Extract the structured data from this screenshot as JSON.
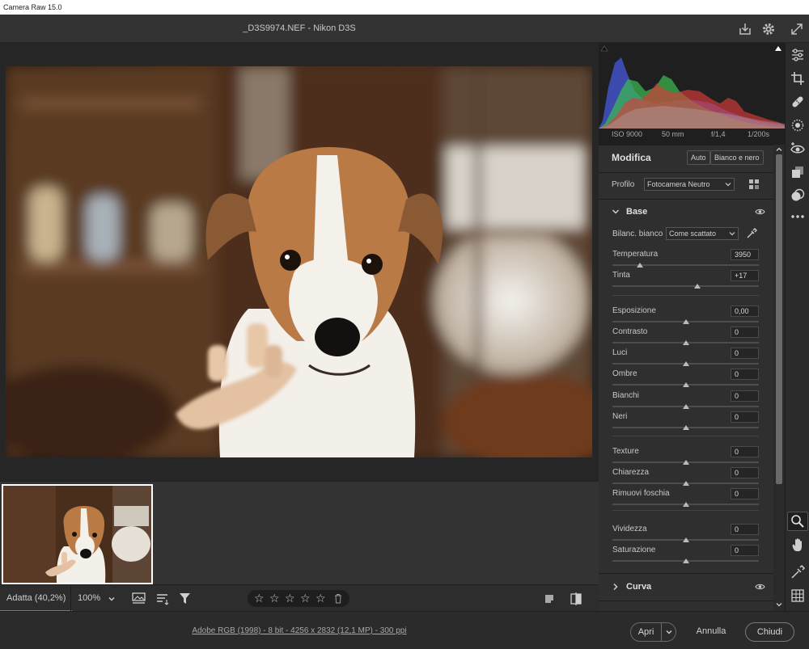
{
  "window": {
    "title": "Camera Raw 15.0"
  },
  "header": {
    "file_title": "_D3S9974.NEF  -  Nikon D3S"
  },
  "histogram": {
    "iso": "ISO 9000",
    "focal": "50 mm",
    "aperture": "f/1,4",
    "shutter": "1/200s"
  },
  "edit": {
    "title": "Modifica",
    "auto_label": "Auto",
    "bw_label": "Bianco e nero",
    "profile_label": "Profilo",
    "profile_value": "Fotocamera Neutro"
  },
  "basic": {
    "title": "Base",
    "wb_label": "Bilanc. bianco",
    "wb_value": "Come scattato",
    "sliders": [
      {
        "label": "Temperatura",
        "value": "3950",
        "pos": 0.19
      },
      {
        "label": "Tinta",
        "value": "+17",
        "pos": 0.58
      },
      {
        "label": "Esposizione",
        "value": "0,00",
        "pos": 0.5
      },
      {
        "label": "Contrasto",
        "value": "0",
        "pos": 0.5
      },
      {
        "label": "Luci",
        "value": "0",
        "pos": 0.5
      },
      {
        "label": "Ombre",
        "value": "0",
        "pos": 0.5
      },
      {
        "label": "Bianchi",
        "value": "0",
        "pos": 0.5
      },
      {
        "label": "Neri",
        "value": "0",
        "pos": 0.5
      },
      {
        "label": "Texture",
        "value": "0",
        "pos": 0.5
      },
      {
        "label": "Chiarezza",
        "value": "0",
        "pos": 0.5
      },
      {
        "label": "Rimuovi foschia",
        "value": "0",
        "pos": 0.5
      },
      {
        "label": "Vividezza",
        "value": "0",
        "pos": 0.5
      },
      {
        "label": "Saturazione",
        "value": "0",
        "pos": 0.5
      }
    ]
  },
  "curve": {
    "title": "Curva"
  },
  "toolbar": {
    "zoom_fit": "Adatta (40,2%)",
    "zoom_100": "100%"
  },
  "status": {
    "info": "Adobe RGB (1998) - 8 bit - 4256 x 2832 (12,1 MP) - 300 ppi"
  },
  "buttons": {
    "open": "Apri",
    "cancel": "Annulla",
    "close": "Chiudi"
  },
  "colors": {
    "accent": "#ffffff",
    "panel_bg": "#2f2f2f",
    "histo_red": "#e04040",
    "histo_green": "#40c040",
    "histo_blue": "#4060e0"
  }
}
